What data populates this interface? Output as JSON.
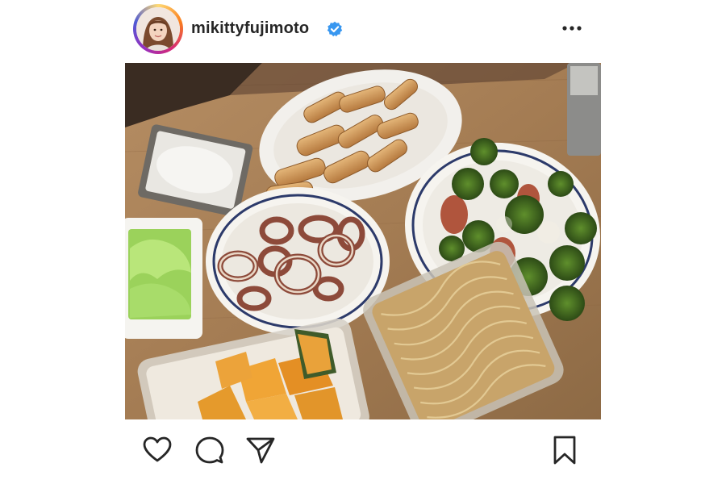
{
  "post": {
    "username": "mikittyfujimoto",
    "verified": true,
    "avatar_icon": "profile-photo",
    "more_icon": "more-options-icon"
  },
  "photo": {
    "subject": "food-photo",
    "dishes": [
      "chicken-wings",
      "broccoli-salad",
      "grilled-squid",
      "lettuce",
      "kabocha-squash",
      "noodles",
      "dip"
    ]
  },
  "actions": {
    "like_icon": "heart-icon",
    "comment_icon": "comment-icon",
    "share_icon": "send-icon",
    "save_icon": "bookmark-icon"
  },
  "colors": {
    "text": "#262626",
    "verified_badge": "#3897f0",
    "story_ring": [
      "#feda75",
      "#fa7e1e",
      "#d62976",
      "#962fbf",
      "#4f5bd5"
    ]
  }
}
